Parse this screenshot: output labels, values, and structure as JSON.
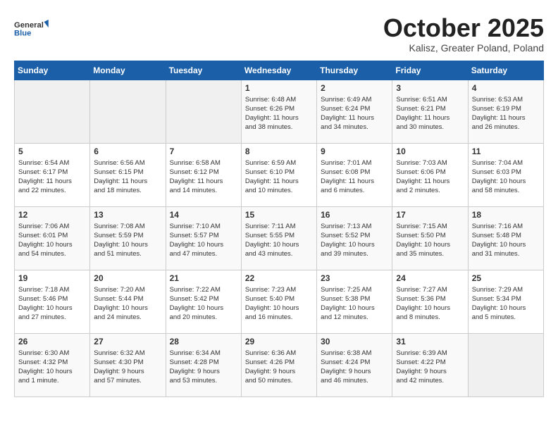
{
  "header": {
    "logo_line1": "General",
    "logo_line2": "Blue",
    "month": "October 2025",
    "location": "Kalisz, Greater Poland, Poland"
  },
  "days_of_week": [
    "Sunday",
    "Monday",
    "Tuesday",
    "Wednesday",
    "Thursday",
    "Friday",
    "Saturday"
  ],
  "weeks": [
    [
      {
        "day": "",
        "info": ""
      },
      {
        "day": "",
        "info": ""
      },
      {
        "day": "",
        "info": ""
      },
      {
        "day": "1",
        "info": "Sunrise: 6:48 AM\nSunset: 6:26 PM\nDaylight: 11 hours\nand 38 minutes."
      },
      {
        "day": "2",
        "info": "Sunrise: 6:49 AM\nSunset: 6:24 PM\nDaylight: 11 hours\nand 34 minutes."
      },
      {
        "day": "3",
        "info": "Sunrise: 6:51 AM\nSunset: 6:21 PM\nDaylight: 11 hours\nand 30 minutes."
      },
      {
        "day": "4",
        "info": "Sunrise: 6:53 AM\nSunset: 6:19 PM\nDaylight: 11 hours\nand 26 minutes."
      }
    ],
    [
      {
        "day": "5",
        "info": "Sunrise: 6:54 AM\nSunset: 6:17 PM\nDaylight: 11 hours\nand 22 minutes."
      },
      {
        "day": "6",
        "info": "Sunrise: 6:56 AM\nSunset: 6:15 PM\nDaylight: 11 hours\nand 18 minutes."
      },
      {
        "day": "7",
        "info": "Sunrise: 6:58 AM\nSunset: 6:12 PM\nDaylight: 11 hours\nand 14 minutes."
      },
      {
        "day": "8",
        "info": "Sunrise: 6:59 AM\nSunset: 6:10 PM\nDaylight: 11 hours\nand 10 minutes."
      },
      {
        "day": "9",
        "info": "Sunrise: 7:01 AM\nSunset: 6:08 PM\nDaylight: 11 hours\nand 6 minutes."
      },
      {
        "day": "10",
        "info": "Sunrise: 7:03 AM\nSunset: 6:06 PM\nDaylight: 11 hours\nand 2 minutes."
      },
      {
        "day": "11",
        "info": "Sunrise: 7:04 AM\nSunset: 6:03 PM\nDaylight: 10 hours\nand 58 minutes."
      }
    ],
    [
      {
        "day": "12",
        "info": "Sunrise: 7:06 AM\nSunset: 6:01 PM\nDaylight: 10 hours\nand 54 minutes."
      },
      {
        "day": "13",
        "info": "Sunrise: 7:08 AM\nSunset: 5:59 PM\nDaylight: 10 hours\nand 51 minutes."
      },
      {
        "day": "14",
        "info": "Sunrise: 7:10 AM\nSunset: 5:57 PM\nDaylight: 10 hours\nand 47 minutes."
      },
      {
        "day": "15",
        "info": "Sunrise: 7:11 AM\nSunset: 5:55 PM\nDaylight: 10 hours\nand 43 minutes."
      },
      {
        "day": "16",
        "info": "Sunrise: 7:13 AM\nSunset: 5:52 PM\nDaylight: 10 hours\nand 39 minutes."
      },
      {
        "day": "17",
        "info": "Sunrise: 7:15 AM\nSunset: 5:50 PM\nDaylight: 10 hours\nand 35 minutes."
      },
      {
        "day": "18",
        "info": "Sunrise: 7:16 AM\nSunset: 5:48 PM\nDaylight: 10 hours\nand 31 minutes."
      }
    ],
    [
      {
        "day": "19",
        "info": "Sunrise: 7:18 AM\nSunset: 5:46 PM\nDaylight: 10 hours\nand 27 minutes."
      },
      {
        "day": "20",
        "info": "Sunrise: 7:20 AM\nSunset: 5:44 PM\nDaylight: 10 hours\nand 24 minutes."
      },
      {
        "day": "21",
        "info": "Sunrise: 7:22 AM\nSunset: 5:42 PM\nDaylight: 10 hours\nand 20 minutes."
      },
      {
        "day": "22",
        "info": "Sunrise: 7:23 AM\nSunset: 5:40 PM\nDaylight: 10 hours\nand 16 minutes."
      },
      {
        "day": "23",
        "info": "Sunrise: 7:25 AM\nSunset: 5:38 PM\nDaylight: 10 hours\nand 12 minutes."
      },
      {
        "day": "24",
        "info": "Sunrise: 7:27 AM\nSunset: 5:36 PM\nDaylight: 10 hours\nand 8 minutes."
      },
      {
        "day": "25",
        "info": "Sunrise: 7:29 AM\nSunset: 5:34 PM\nDaylight: 10 hours\nand 5 minutes."
      }
    ],
    [
      {
        "day": "26",
        "info": "Sunrise: 6:30 AM\nSunset: 4:32 PM\nDaylight: 10 hours\nand 1 minute."
      },
      {
        "day": "27",
        "info": "Sunrise: 6:32 AM\nSunset: 4:30 PM\nDaylight: 9 hours\nand 57 minutes."
      },
      {
        "day": "28",
        "info": "Sunrise: 6:34 AM\nSunset: 4:28 PM\nDaylight: 9 hours\nand 53 minutes."
      },
      {
        "day": "29",
        "info": "Sunrise: 6:36 AM\nSunset: 4:26 PM\nDaylight: 9 hours\nand 50 minutes."
      },
      {
        "day": "30",
        "info": "Sunrise: 6:38 AM\nSunset: 4:24 PM\nDaylight: 9 hours\nand 46 minutes."
      },
      {
        "day": "31",
        "info": "Sunrise: 6:39 AM\nSunset: 4:22 PM\nDaylight: 9 hours\nand 42 minutes."
      },
      {
        "day": "",
        "info": ""
      }
    ]
  ]
}
